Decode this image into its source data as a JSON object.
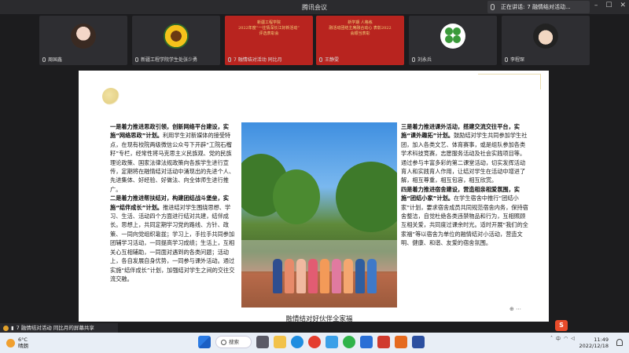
{
  "window": {
    "title": "腾讯会议"
  },
  "speaking": {
    "prefix": "正在讲话:",
    "name": "7 融情结对活动..."
  },
  "participants": [
    {
      "name": "周国鑫",
      "avatar": "photo-girl"
    },
    {
      "name": "新疆工程学院学生处张少勇",
      "avatar": "sunflower"
    },
    {
      "name": "7 融情结对活动 同比月",
      "avatar": "poster"
    },
    {
      "name": "王静雯",
      "avatar": "poster"
    },
    {
      "name": "刘永兵",
      "avatar": "clover"
    },
    {
      "name": "李程琛",
      "avatar": "cartoon"
    }
  ],
  "posters": {
    "p1": {
      "line1": "新疆工程学院",
      "line2": "2022年度“一往情深长江好新活动”",
      "line3": "评选表彰会"
    },
    "p2": {
      "line1": "新学期 人格练",
      "line2": "融活动团结主席融合动心 表彰2022",
      "line3": "会顺当表彰"
    }
  },
  "document": {
    "left": {
      "h1": "一是着力推进思政引领，创新网络平台建设，实施“网络思政”计划。",
      "p1": "利用学生对新媒体的接受特点，在现有校院两级微信公众号下开辟“工院石榴籽”专栏，经常性将马克思主义民族观、党的民族理论政策、国家法律法规政策向各族学生进行宣传，定期将在融情结对活动中涌现出的先进个人、先进集体、好经验、好做法、向全体师生进行推广。",
      "h2": "二是着力推进帮扶结对，构建团结战斗堡垒，实施“结伴成长”计划。",
      "p2": "推进结对学生围绕思想、学习、生活、活动四个方面进行结对共建，结伴成长。思想上，共同定期学习党的路线、方针、政策、一同向党组织靠拢；学习上，手拉手共同参加团辅学习活动，一同提高学习成绩；生活上，互相关心互相辅助，一同面对遇到的各类问题；活动上，各自发展自身优势，一同参与课外活动。通过实施“结伴成长”计划，加强结对学生之间的交往交流交融。"
    },
    "right": {
      "h1": "三是着力推进课外活动，搭建交流交往平台，实施“课外趣拓”计划。",
      "p1": "鼓励结对学生共同参加学生社团，加入各类文艺、体育赛事，或是组队参加各类学术科技竞赛，志愿服务活动及社会实践项目等。通过参与丰富多彩的第二课堂活动，切实发挥活动育人和实践育人作用，让结对学生在活动中增进了解，相互尊重，相互包容，相互欣赏。",
      "h2": "四是着力推进宿舍建设，营造相亲相爱氛围，实施“团结小家”计划。",
      "p2": "在学生宿舍中推行“团结小家”计划，要求宿舍成员共同规范宿舍内务，保持宿舍整洁，自觉杜绝各类违禁物品和行为，互相照顾互相关爱，共同度过课余时光。适时开展“我们的全家福”等以宿舍为单位的融情结对小活动，营造文明、健康、和谐、友爱的宿舍氛围。"
    },
    "caption": "融情结对好伙伴全家福"
  },
  "sharebar": {
    "text": "7 融情结对活动 同比月的屏幕共享"
  },
  "taskbar": {
    "weather_temp": "6°C",
    "weather_desc": "晴朗",
    "search": "搜索",
    "ime": "中",
    "time": "11:49",
    "date": "2022/12/18"
  },
  "colors": {
    "poster_red": "#b8241f",
    "accent": "#e84b2a"
  }
}
